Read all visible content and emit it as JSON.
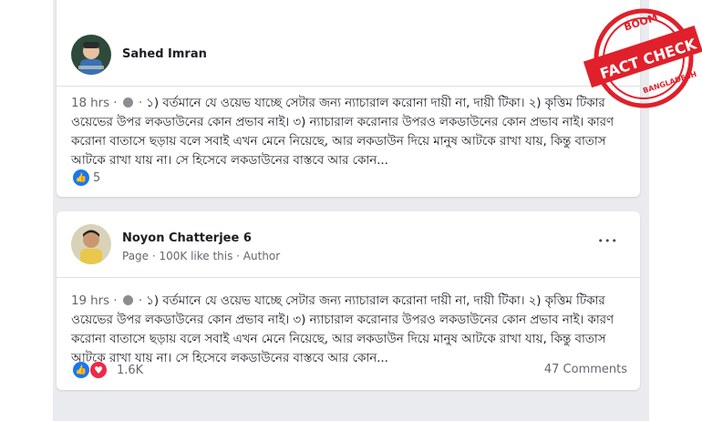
{
  "posts": [
    {
      "author": "Sahed Imran",
      "time": "18 hrs",
      "dot": "·",
      "text": "১) বর্তমানে যে ওয়েভ যাচ্ছে সেটার জন্য ন্যাচারাল করোনা দায়ী না, দায়ী টিকা। ২) কৃত্তিম টিকার ওয়েভের উপর লকডাউনের কোন প্রভাব নাই। ৩) ন্যাচারাল করোনার উপরও লকডাউনের কোন প্রভাব নাই। কারণ করোনা বাতাসে ছড়ায় বলে সবাই এখন মেনে নিয়েছে, আর লকডাউন দিয়ে মানুষ আটকে রাখা যায়, কিন্তু বাতাস আটকে রাখা যায় না। সে হিসেবে লকডাউনের বাস্তবে আর কোন...",
      "reaction_count": "5"
    },
    {
      "author": "Noyon Chatterjee 6",
      "subtitle": "Page · 100K like this · Author",
      "time": "19 hrs",
      "dot": "·",
      "text": "১) বর্তমানে যে ওয়েভ যাচ্ছে সেটার জন্য ন্যাচারাল করোনা দায়ী না, দায়ী টিকা। ২) কৃত্তিম টিকার ওয়েভের উপর লকডাউনের কোন প্রভাব নাই। ৩) ন্যাচারাল করোনার উপরও লকডাউনের কোন প্রভাব নাই। কারণ করোনা বাতাসে ছড়ায় বলে সবাই এখন মেনে নিয়েছে, আর লকডাউন দিয়ে মানুষ আটকে রাখা যায়, কিন্তু বাতাস আটকে রাখা যায় না। সে হিসেবে লকডাউনের বাস্তবে আর কোন...",
      "reaction_count": "1.6K",
      "comments": "47 Comments",
      "more": "•••"
    }
  ],
  "stamp": {
    "top": "BOOM",
    "middle": "FACT CHECK",
    "bottom": "BANGLADESH",
    "color": "#e0202a"
  },
  "colors": {
    "like": "#1877f2",
    "love": "#f0284a",
    "feed_bg": "#e9ebee"
  },
  "icons": [
    "globe-icon",
    "like-icon",
    "love-icon",
    "more-icon"
  ]
}
